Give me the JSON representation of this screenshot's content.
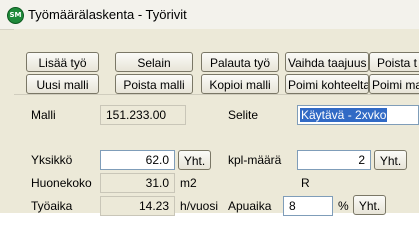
{
  "window": {
    "title": "Työmäärälaskenta - Työrivit",
    "icon": "app-logo-icon",
    "icon_text": "SM"
  },
  "toolbar": {
    "row1": [
      "Lisää työ",
      "Selain",
      "Palauta työ",
      "Vaihda taajuus",
      "Poista t"
    ],
    "row2": [
      "Uusi malli",
      "Poista malli",
      "Kopioi malli",
      "Poimi kohteelta",
      "Poimi mall"
    ]
  },
  "form": {
    "malli_label": "Malli",
    "malli_value": "151.233.00",
    "selite_label": "Selite",
    "selite_value": "Käytävä - 2xvko",
    "yksikko_label": "Yksikkö",
    "yksikko_value": "62.0",
    "yksikko_button": "Yht.",
    "kpl_label": "kpl-määrä",
    "kpl_value": "2",
    "kpl_button": "Yht.",
    "huonekoko_label": "Huonekoko",
    "huonekoko_value": "31.0",
    "huonekoko_unit": "m2",
    "r_label": "R",
    "tyoaika_label": "Työaika",
    "tyoaika_value": "14.23",
    "tyoaika_unit": "h/vuosi",
    "apuaika_label": "Apuaika",
    "apuaika_value": "8",
    "apuaika_unit": "%",
    "apuaika_button": "Yht."
  }
}
